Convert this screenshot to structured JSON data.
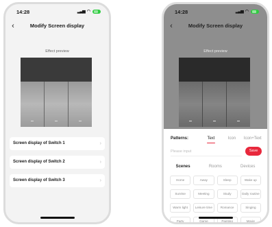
{
  "status": {
    "time": "14:28"
  },
  "left": {
    "title": "Modify Screen display",
    "preview_label": "Effect preview",
    "items": [
      {
        "label": "Screen display of Switch 1"
      },
      {
        "label": "Screen display of Switch 2"
      },
      {
        "label": "Screen display of Switch 3"
      }
    ]
  },
  "right": {
    "title": "Modify Screen display",
    "preview_label": "Effect preview",
    "patterns_label": "Patterns:",
    "pattern_tabs": [
      {
        "label": "Text",
        "active": true
      },
      {
        "label": "Icon",
        "active": false
      },
      {
        "label": "Icon+Text",
        "active": false
      }
    ],
    "input_placeholder": "Please input",
    "save_label": "Save",
    "category_tabs": [
      {
        "label": "Scenes",
        "active": true
      },
      {
        "label": "Rooms",
        "active": false
      },
      {
        "label": "Devices",
        "active": false
      }
    ],
    "chips": [
      "Home",
      "Away",
      "Sleep",
      "Wake up",
      "Sunrise",
      "Meeting",
      "Study",
      "Daily routine",
      "Warm light",
      "Leisure time",
      "Romance",
      "Singing",
      "Party",
      "Game",
      "Painting",
      "Movie"
    ]
  },
  "colors": {
    "accent": "#e8283c",
    "battery": "#2ecc40"
  },
  "icons": [
    "back-arrow-icon",
    "chevron-right-icon",
    "signal-icon",
    "wifi-icon",
    "battery-icon"
  ]
}
